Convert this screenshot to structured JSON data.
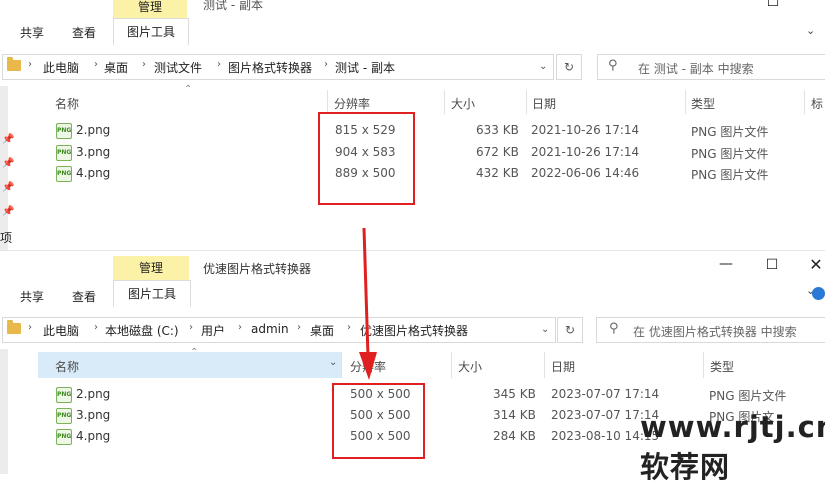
{
  "window1": {
    "title": "测试 - 副本",
    "ribbon": {
      "manage": "管理",
      "tabs": [
        "共享",
        "查看",
        "图片工具"
      ]
    },
    "breadcrumb": [
      "此电脑",
      "桌面",
      "测试文件",
      "图片格式转换器",
      "测试 - 副本"
    ],
    "search_placeholder": "在 测试 - 副本 中搜索",
    "columns": [
      "名称",
      "分辨率",
      "大小",
      "日期",
      "类型",
      "标"
    ],
    "files": [
      {
        "name": "2.png",
        "resolution": "815 x 529",
        "size": "633 KB",
        "date": "2021-10-26 17:14",
        "type": "PNG 图片文件"
      },
      {
        "name": "3.png",
        "resolution": "904 x 583",
        "size": "672 KB",
        "date": "2021-10-26 17:14",
        "type": "PNG 图片文件"
      },
      {
        "name": "4.png",
        "resolution": "889 x 500",
        "size": "432 KB",
        "date": "2022-06-06 14:46",
        "type": "PNG 图片文件"
      }
    ],
    "side_text": "项"
  },
  "window2": {
    "title": "优速图片格式转换器",
    "ribbon": {
      "manage": "管理",
      "tabs": [
        "共享",
        "查看",
        "图片工具"
      ]
    },
    "breadcrumb": [
      "此电脑",
      "本地磁盘 (C:)",
      "用户",
      "admin",
      "桌面",
      "优速图片格式转换器"
    ],
    "search_placeholder": "在 优速图片格式转换器 中搜索",
    "columns": [
      "名称",
      "分辨率",
      "大小",
      "日期",
      "类型"
    ],
    "files": [
      {
        "name": "2.png",
        "resolution": "500 x 500",
        "size": "345 KB",
        "date": "2023-07-07 17:14",
        "type": "PNG 图片文件"
      },
      {
        "name": "3.png",
        "resolution": "500 x 500",
        "size": "314 KB",
        "date": "2023-07-07 17:14",
        "type": "PNG 图片文"
      },
      {
        "name": "4.png",
        "resolution": "500 x 500",
        "size": "284 KB",
        "date": "2023-08-10 14:15",
        "type": ""
      }
    ]
  },
  "icons": {
    "file": "png-file-icon",
    "pin": "pin-icon",
    "refresh": "refresh-icon",
    "search": "search-icon",
    "folder": "folder-icon"
  },
  "colors": {
    "highlight": "#e02020",
    "manage_bg": "#fbf2a8",
    "selected_header": "#d9ebf9"
  },
  "watermark": "www.rjtj.cn软荐网"
}
